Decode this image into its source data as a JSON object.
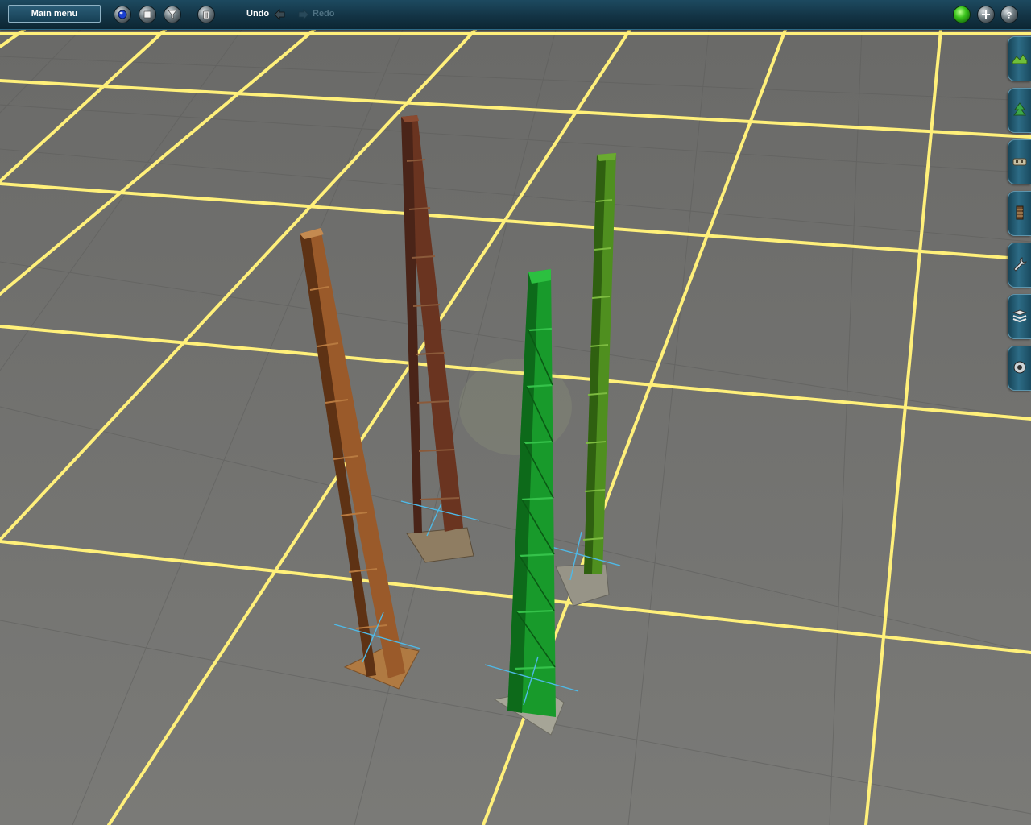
{
  "toolbar": {
    "main_menu_label": "Main menu",
    "undo_label": "Undo",
    "redo_label": "Redo",
    "tool_buttons": [
      "globe-icon",
      "stop-icon",
      "filter-icon",
      "trash-icon"
    ],
    "right_buttons": [
      "status-light-icon",
      "add-icon",
      "help-icon"
    ]
  },
  "side_palette": {
    "tabs": [
      {
        "name": "terrain-icon"
      },
      {
        "name": "scenery-icon"
      },
      {
        "name": "track-icon"
      },
      {
        "name": "railroad-object-icon"
      },
      {
        "name": "tools-icon"
      },
      {
        "name": "layers-icon"
      },
      {
        "name": "settings-icon"
      }
    ]
  },
  "viewport": {
    "ground_color": "#6f6f6c",
    "grid_color": "#fff07a",
    "objects": [
      {
        "name": "tower-rust-light",
        "color": "#9a5a2a"
      },
      {
        "name": "tower-rust-dark",
        "color": "#6a3420"
      },
      {
        "name": "tower-green-bright",
        "color": "#189a2b"
      },
      {
        "name": "tower-green-olive",
        "color": "#4f8f1f"
      }
    ]
  },
  "colors": {
    "toolbar_bg": "#133445",
    "accent": "#2d6c86",
    "redo_disabled": "#4f7283"
  }
}
